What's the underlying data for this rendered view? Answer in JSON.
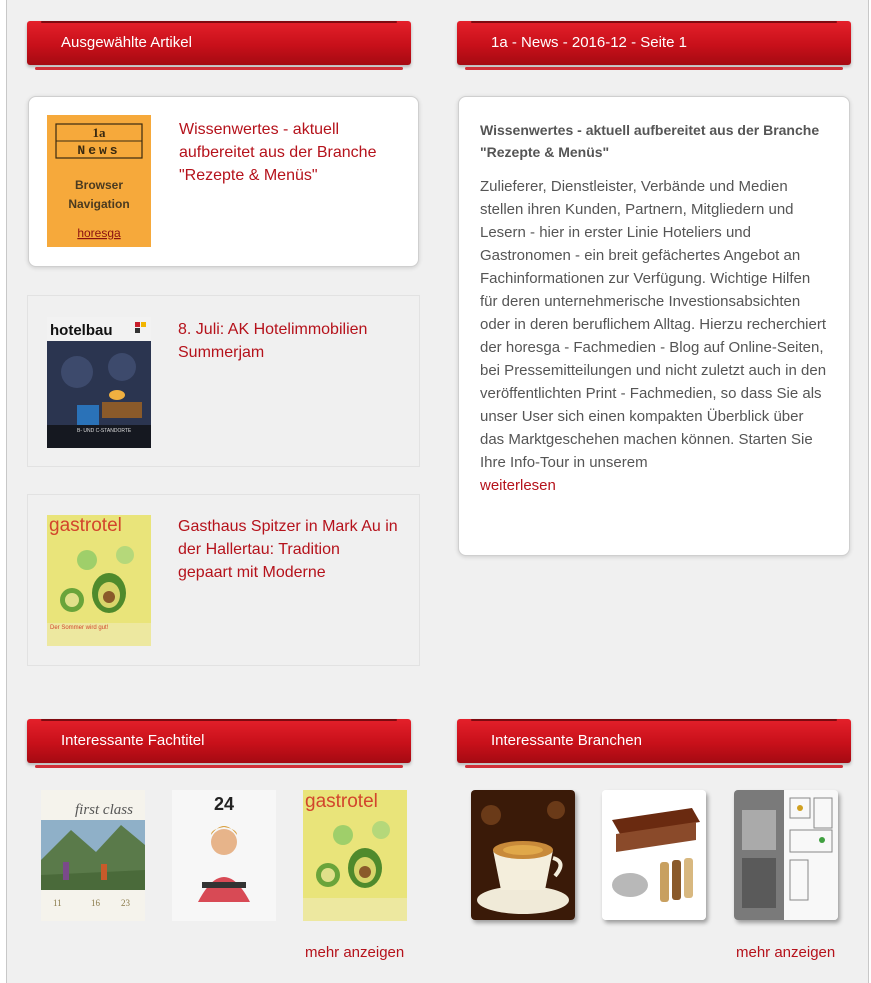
{
  "left_column": {
    "header": "Ausgewählte Artikel",
    "articles": [
      {
        "title": "Wissenwertes - aktuell aufbereitet aus der Branche \"Rezepte & Menüs\"",
        "thumb": {
          "line1": "1a",
          "line2": "News",
          "line3": "Browser",
          "line4": "Navigation",
          "brand": "horesga"
        }
      },
      {
        "title": "8. Juli: AK Hotelimmobilien Summerjam",
        "thumb": {
          "brand": "hotelbau"
        }
      },
      {
        "title": "Gasthaus Spitzer in Mark Au in der Hallertau: Tradition gepaart mit Moderne",
        "thumb": {
          "brand": "gastrotel"
        }
      }
    ]
  },
  "right_column": {
    "header": "1a - News - 2016-12 - Seite 1",
    "news": {
      "title": "Wissenwertes - aktuell aufbereitet aus der Branche \"Rezepte & Menüs\"",
      "body": "Zulieferer, Dienstleister, Verbände und Medien stellen ihren Kunden, Partnern, Mitgliedern und Lesern - hier in erster Linie Hoteliers und Gastronomen - ein breit gefächertes Angebot an Fachinformationen zur Verfügung. Wichtige Hilfen für deren unternehmerische Investionsabsichten oder in deren beruflichem Alltag. Hierzu recherchiert der horesga - Fachmedien - Blog auf Online-Seiten, bei Pressemitteilungen und nicht zuletzt auch in den veröffentlichten Print - Fachmedien, so dass Sie als unser User sich einen kompakten Überblick über das Marktgeschehen machen können. Starten Sie Ihre Info-Tour in unserem",
      "more": "weiterlesen"
    }
  },
  "fachtitel": {
    "header": "Interessante Fachtitel",
    "magazines": [
      {
        "brand": "first class"
      },
      {
        "brand": "24"
      },
      {
        "brand": "gastrotel"
      }
    ],
    "more": "mehr anzeigen"
  },
  "branchen": {
    "header": "Interessante Branchen",
    "items": [
      {
        "name": "coffee-cup-image"
      },
      {
        "name": "buffet-station-image"
      },
      {
        "name": "kitchen-plan-image"
      }
    ],
    "more": "mehr anzeigen"
  },
  "colors": {
    "accent": "#c8101a",
    "link": "#b5121b",
    "text": "#555555",
    "background": "#f0f0f0"
  }
}
